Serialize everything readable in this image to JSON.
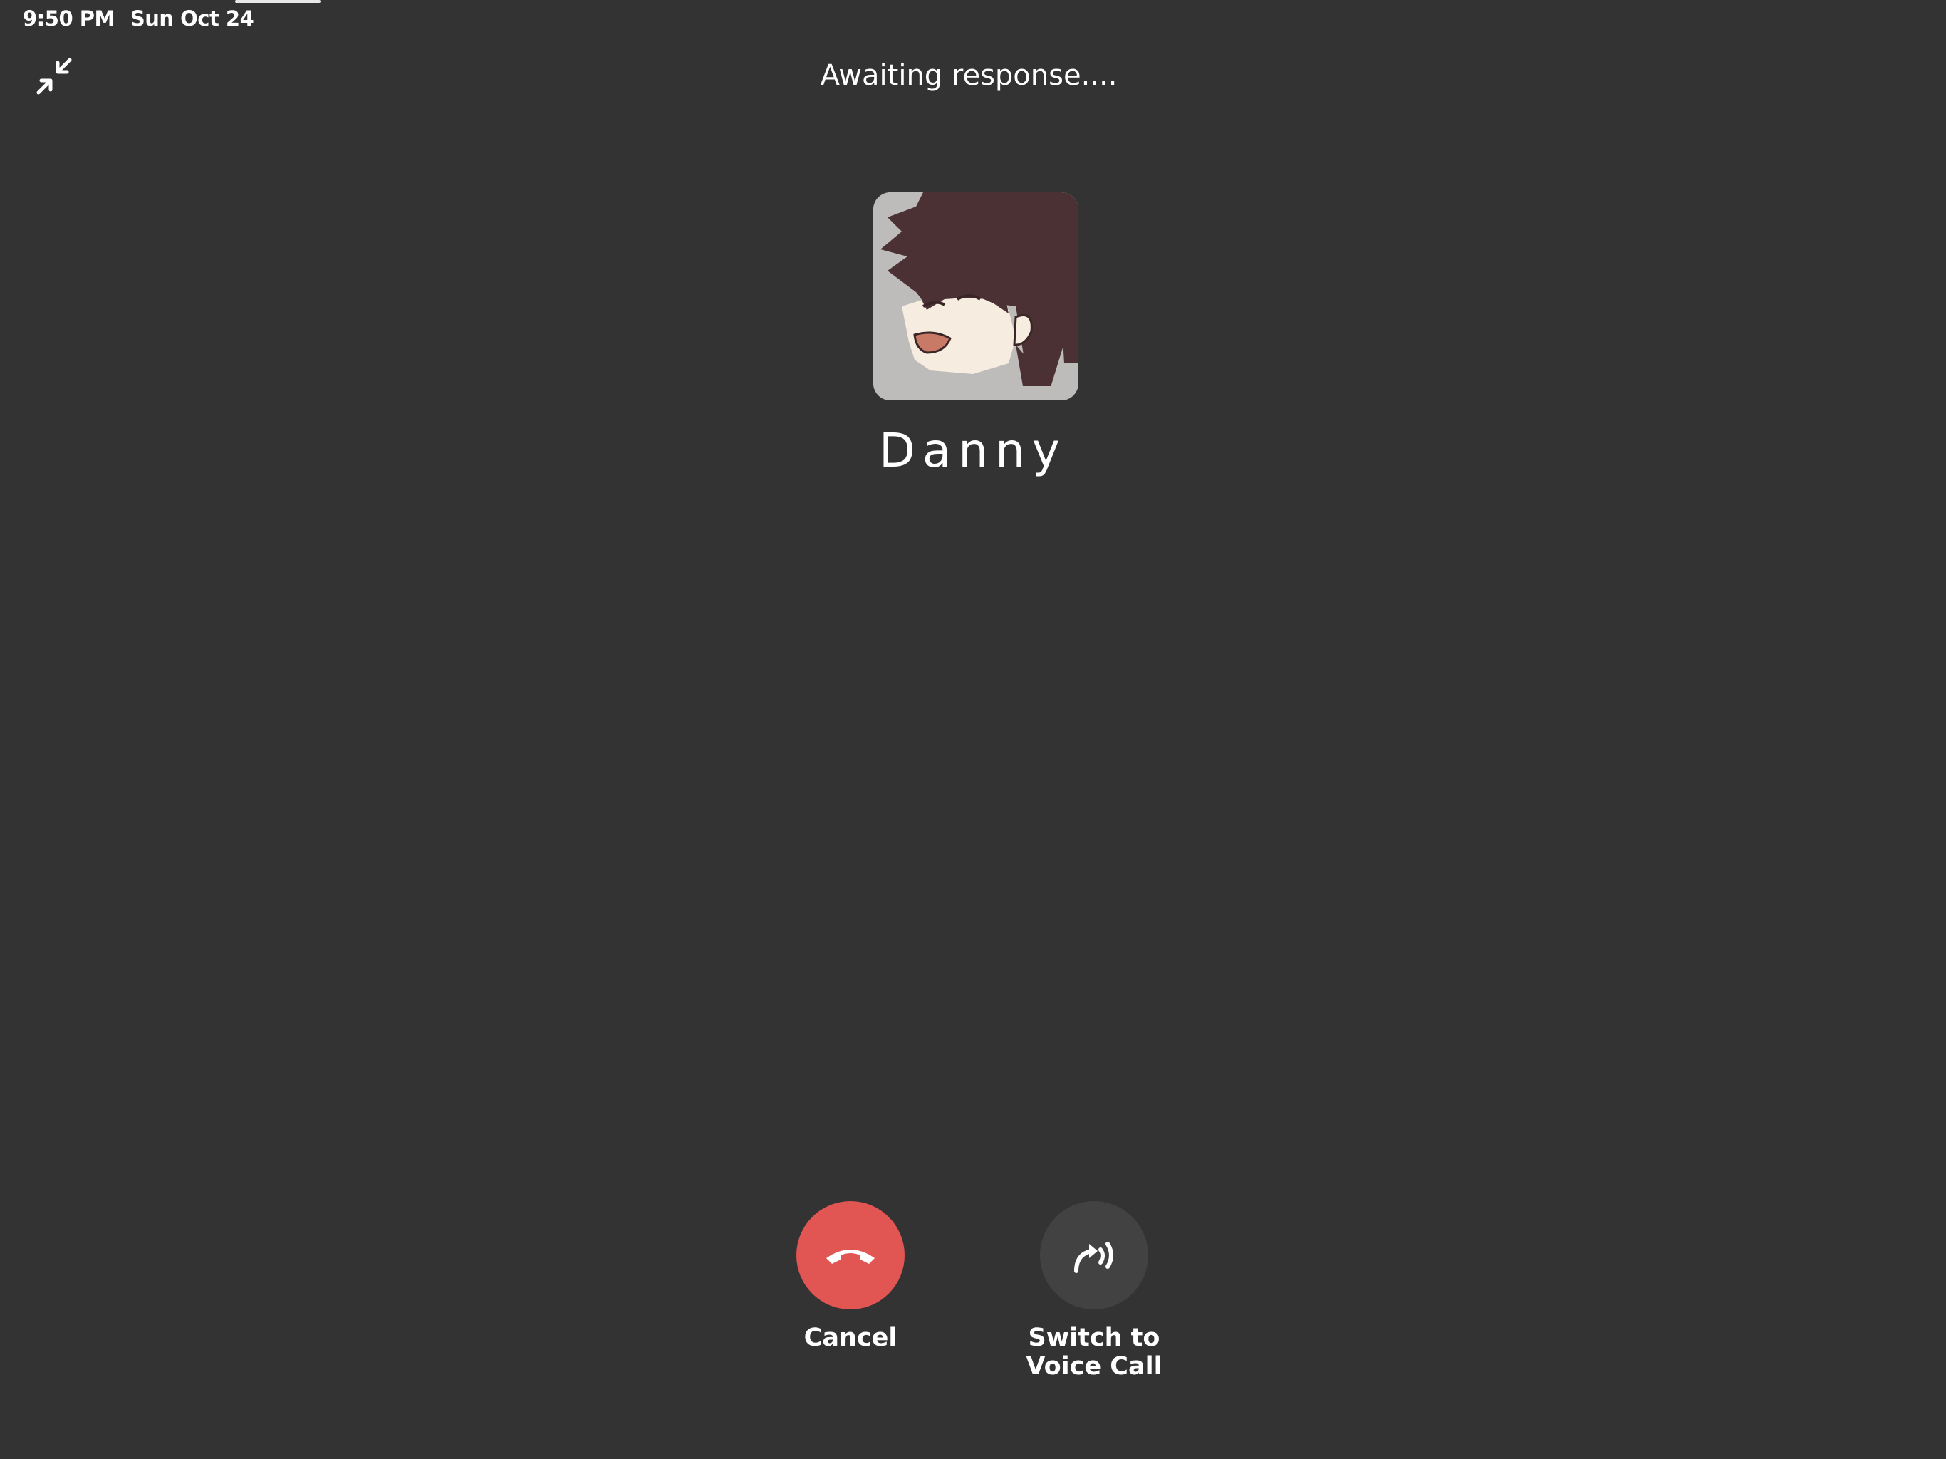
{
  "status_bar": {
    "time": "9:50 PM",
    "date": "Sun Oct 24"
  },
  "call": {
    "status_text": "Awaiting response....",
    "contact_name": "Danny",
    "avatar_icon": "anime-character-avatar"
  },
  "actions": {
    "cancel_label": "Cancel",
    "voice_label": "Switch to\nVoice Call",
    "cancel_color": "#e15553",
    "voice_color": "#424242"
  },
  "icons": {
    "minimize": "minimize-arrows-icon",
    "cancel": "hang-up-phone-icon",
    "voice": "voice-call-icon"
  },
  "colors": {
    "background": "#333333",
    "text": "#ffffff"
  }
}
